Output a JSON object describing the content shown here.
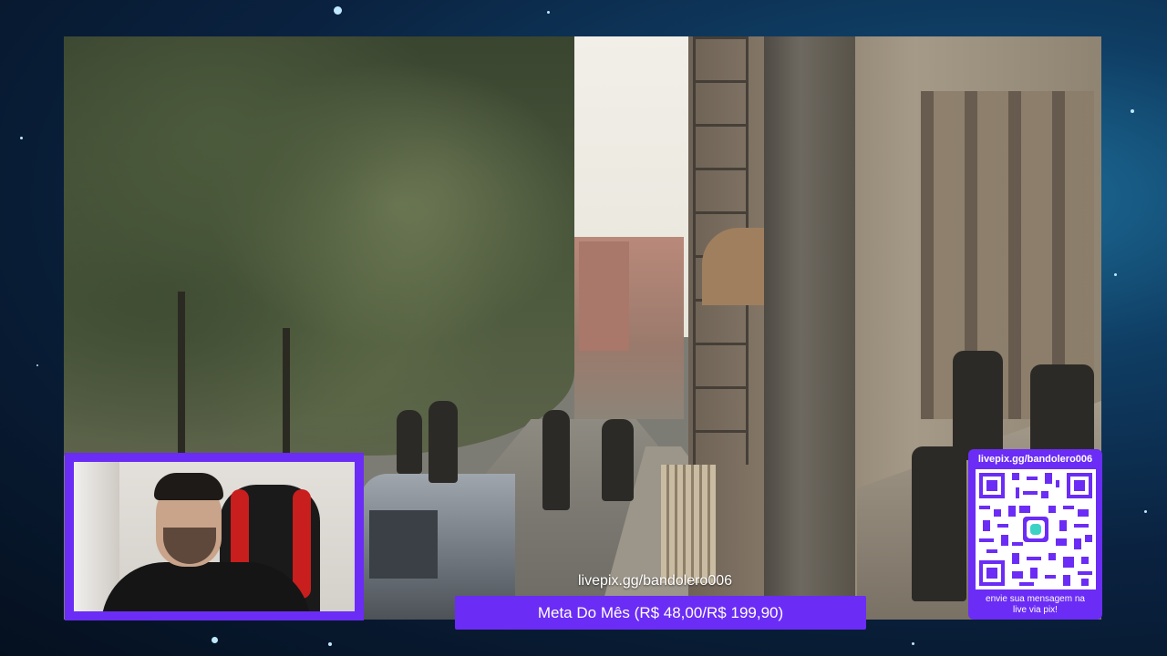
{
  "stream_overlay": {
    "pix_url_caption": "livepix.gg/bandolero006",
    "goal_label": "Meta Do Mês (R$ 48,00/R$ 199,90)",
    "pix_box": {
      "url": "livepix.gg/bandolero006",
      "message_line1": "envie sua mensagem na",
      "message_line2": "live via pix!"
    }
  },
  "colors": {
    "accent_purple": "#6b2cf5",
    "background_space": "#0a2240"
  },
  "icons": {
    "qr_code": "qr-code-icon",
    "qr_center_logo": "livepix-logo-icon"
  }
}
